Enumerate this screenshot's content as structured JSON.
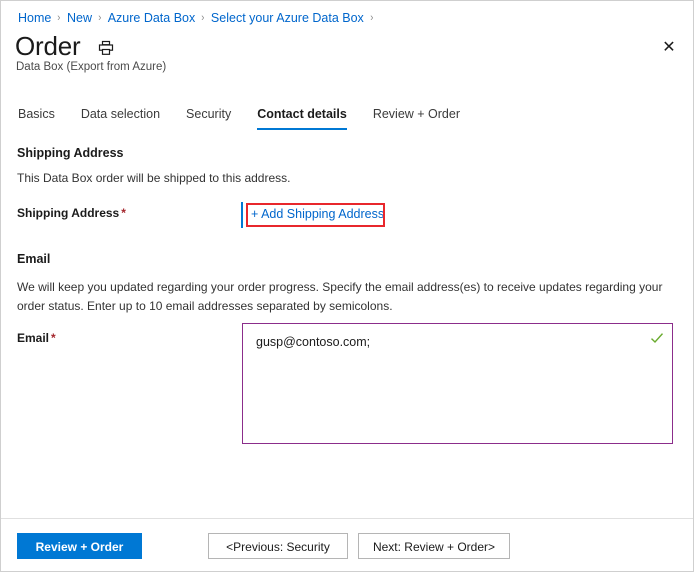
{
  "breadcrumb": {
    "items": [
      {
        "label": "Home"
      },
      {
        "label": "New"
      },
      {
        "label": "Azure Data Box"
      },
      {
        "label": "Select your Azure Data Box"
      }
    ],
    "separator": "›"
  },
  "header": {
    "title": "Order",
    "subtitle": "Data Box (Export from Azure)",
    "print_icon": "printer-icon",
    "close_icon": "✕"
  },
  "tabs": [
    {
      "label": "Basics",
      "active": false
    },
    {
      "label": "Data selection",
      "active": false
    },
    {
      "label": "Security",
      "active": false
    },
    {
      "label": "Contact details",
      "active": true
    },
    {
      "label": "Review + Order",
      "active": false
    }
  ],
  "shipping": {
    "heading": "Shipping Address",
    "description": "This Data Box order will be shipped to this address.",
    "field_label": "Shipping Address",
    "required_marker": "*",
    "add_link": "+ Add Shipping Address"
  },
  "email": {
    "heading": "Email",
    "description": "We will keep you updated regarding your order progress. Specify the email address(es) to receive updates regarding your order status. Enter up to 10 email addresses separated by semicolons.",
    "field_label": "Email",
    "required_marker": "*",
    "value": "gusp@contoso.com;",
    "valid_icon": "check-icon"
  },
  "footer": {
    "primary_label": "Review + Order",
    "previous_label": "<Previous: Security",
    "next_label": "Next: Review + Order>"
  },
  "colors": {
    "accent_blue": "#0078d4",
    "link_blue": "#0066cc",
    "highlight_red": "#e8272c",
    "field_purple": "#8b2d8b",
    "valid_green": "#6aab2f",
    "required_red": "#a4262c"
  }
}
